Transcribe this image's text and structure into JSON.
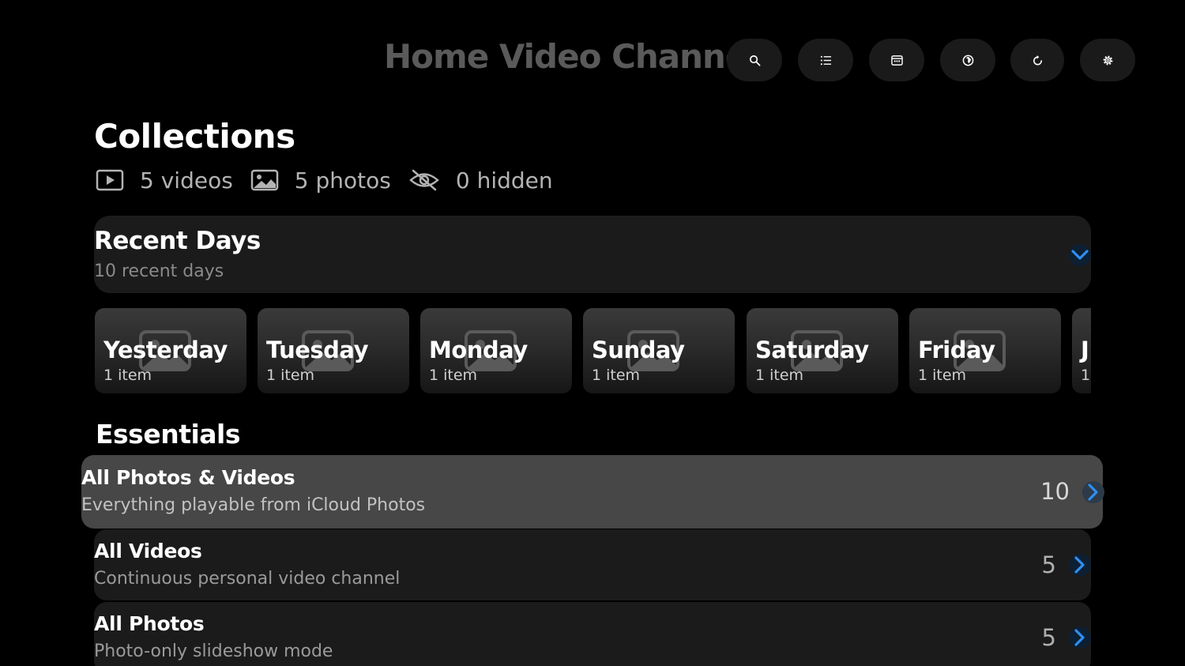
{
  "app": {
    "title": "Home Video Channel"
  },
  "toolbar": {
    "buttons": [
      {
        "name": "search",
        "icon": "search-icon"
      },
      {
        "name": "list",
        "icon": "list-icon"
      },
      {
        "name": "calendar",
        "icon": "calendar-icon"
      },
      {
        "name": "globe",
        "icon": "globe-icon"
      },
      {
        "name": "refresh",
        "icon": "refresh-icon"
      },
      {
        "name": "settings",
        "icon": "gear-icon"
      }
    ]
  },
  "collections": {
    "title": "Collections",
    "videos": "5 videos",
    "photos": "5 photos",
    "hidden": "0 hidden"
  },
  "recent_days": {
    "title": "Recent Days",
    "subtitle": "10 recent days",
    "days": [
      {
        "name": "Yesterday",
        "count": "1 item"
      },
      {
        "name": "Tuesday",
        "count": "1 item"
      },
      {
        "name": "Monday",
        "count": "1 item"
      },
      {
        "name": "Sunday",
        "count": "1 item"
      },
      {
        "name": "Saturday",
        "count": "1 item"
      },
      {
        "name": "Friday",
        "count": "1 item"
      },
      {
        "name": "J",
        "count": "1"
      }
    ]
  },
  "essentials": {
    "title": "Essentials",
    "rows": [
      {
        "title": "All Photos & Videos",
        "subtitle": "Everything playable from iCloud Photos",
        "count": "10",
        "focused": true
      },
      {
        "title": "All Videos",
        "subtitle": "Continuous personal video channel",
        "count": "5",
        "focused": false
      },
      {
        "title": "All Photos",
        "subtitle": "Photo-only slideshow mode",
        "count": "5",
        "focused": false
      }
    ]
  },
  "colors": {
    "background": "#000000",
    "panel": "#1b1b1b",
    "focused_row": "#474747",
    "accent": "#2f8ff0",
    "muted_text": "#8a8a8a"
  }
}
